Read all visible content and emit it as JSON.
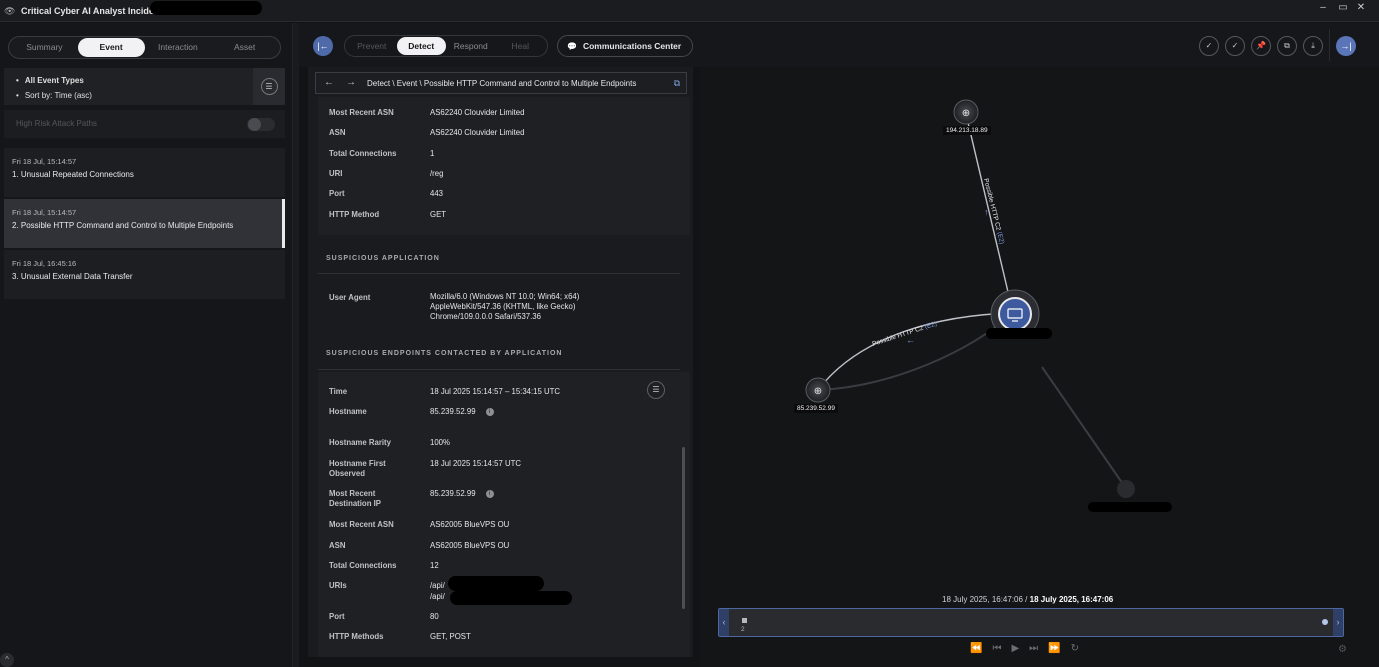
{
  "window": {
    "title": "Critical Cyber AI Analyst Incident",
    "controls": [
      "–",
      "▭",
      "✕"
    ]
  },
  "left": {
    "tabs": [
      {
        "label": "Summary",
        "active": false
      },
      {
        "label": "Event",
        "active": true
      },
      {
        "label": "Interaction",
        "active": false
      },
      {
        "label": "Asset",
        "active": false
      }
    ],
    "filters": {
      "types": "All Event Types",
      "sort": "Sort by: Time (asc)",
      "icon": "filter-sliders-icon"
    },
    "attack_paths_label": "High Risk Attack Paths",
    "attack_paths_enabled": false,
    "events": [
      {
        "time": "Fri 18 Jul, 15:14:57",
        "name": "1. Unusual Repeated Connections",
        "selected": false
      },
      {
        "time": "Fri 18 Jul, 15:14:57",
        "name": "2. Possible HTTP Command and Control to Multiple Endpoints",
        "selected": true
      },
      {
        "time": "Fri 18 Jul, 16:45:16",
        "name": "3. Unusual External Data Transfer",
        "selected": false
      }
    ]
  },
  "toolbar": {
    "stages": [
      {
        "label": "Prevent",
        "active": false
      },
      {
        "label": "Detect",
        "active": true
      },
      {
        "label": "Respond",
        "active": false
      },
      {
        "label": "Heal",
        "active": false
      }
    ],
    "comm_center": "Communications Center",
    "accent": "#4f6aa8"
  },
  "detail": {
    "breadcrumb": "Detect \\ Event \\ Possible HTTP Command and Control to Multiple Endpoints",
    "top_rows": [
      {
        "label": "Most Recent ASN",
        "value": "AS62240 Clouvider Limited"
      },
      {
        "label": "ASN",
        "value": "AS62240 Clouvider Limited"
      },
      {
        "label": "Total Connections",
        "value": "1"
      },
      {
        "label": "URI",
        "value": "/reg"
      },
      {
        "label": "Port",
        "value": "443"
      },
      {
        "label": "HTTP Method",
        "value": "GET"
      }
    ],
    "suspicious_app": {
      "heading": "SUSPICIOUS APPLICATION",
      "ua_label": "User Agent",
      "ua_lines": [
        "Mozilla/6.0 (Windows NT 10.0; Win64; x64)",
        "AppleWebKit/547.36 (KHTML, like Gecko)",
        "Chrome/109.0.0.0 Safari/537.36"
      ]
    },
    "endpoints": {
      "heading": "SUSPICIOUS ENDPOINTS CONTACTED BY APPLICATION",
      "rows": [
        {
          "label": "Time",
          "value": "18 Jul 2025 15:14:57 – 15:34:15 UTC"
        },
        {
          "label": "Hostname",
          "value": "85.239.52.99"
        },
        {
          "label": "Hostname Rarity",
          "value": "100%"
        },
        {
          "label": "Hostname First Observed",
          "value": "18 Jul 2025 15:14:57 UTC"
        },
        {
          "label": "Most Recent Destination IP",
          "value": "85.239.52.99"
        },
        {
          "label": "Most Recent ASN",
          "value": "AS62005 BlueVPS OU"
        },
        {
          "label": "ASN",
          "value": "AS62005 BlueVPS OU"
        },
        {
          "label": "Total Connections",
          "value": "12"
        },
        {
          "label": "URIs",
          "value1": "/api/",
          "value2": "/api/"
        },
        {
          "label": "Port",
          "value": "80"
        },
        {
          "label": "HTTP Methods",
          "value": "GET, POST"
        }
      ]
    }
  },
  "graph": {
    "nodes": [
      {
        "label": "194.213.18.89",
        "icon": "globe-icon"
      },
      {
        "label": "85.239.52.99",
        "icon": "globe-icon"
      },
      {
        "label": "",
        "icon": "computer-icon"
      }
    ],
    "edges": [
      {
        "label": "Possible HTTP C2",
        "ref": "(E2)"
      },
      {
        "label": "Possible HTTP C2",
        "ref": "(E2)"
      }
    ],
    "time_start": "18 July 2025, 16:47:06",
    "time_sep": " / ",
    "time_end": "18 July 2025, 16:47:06",
    "timeline_count": "2"
  }
}
